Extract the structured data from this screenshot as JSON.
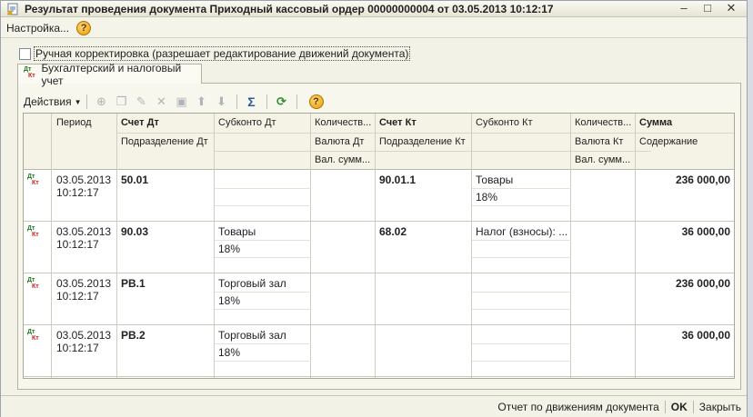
{
  "window": {
    "title": "Результат проведения документа Приходный кассовый ордер 00000000004 от 03.05.2013 10:12:17",
    "buttons": {
      "minimize": "–",
      "maximize": "□",
      "close": "✕"
    }
  },
  "menubar": {
    "settings_label": "Настройка...",
    "help_glyph": "?"
  },
  "manual_correction": {
    "label": "Ручная корректировка (разрешает редактирование движений документа)",
    "checked": false
  },
  "tab": {
    "label": "Бухгалтерский и налоговый учет",
    "icon_dt": "Дт",
    "icon_kt": "Кт"
  },
  "toolbar": {
    "actions_label": "Действия",
    "icons": [
      "add-icon",
      "copy-icon",
      "edit-icon",
      "delete-icon",
      "save-icon",
      "move-up-icon",
      "move-down-icon",
      "sum-icon",
      "refresh-icon",
      "help-icon"
    ]
  },
  "grid": {
    "header": {
      "period": "Период",
      "account_dt": "Счет Дт",
      "subconto_dt": "Субконто Дт",
      "quantity_dt": "Количеств...",
      "account_kt": "Счет Кт",
      "subconto_kt": "Субконто Кт",
      "quantity_kt": "Количеств...",
      "amount": "Сумма",
      "division_dt": "Подразделение Дт",
      "currency_dt": "Валюта Дт",
      "division_kt": "Подразделение Кт",
      "currency_kt": "Валюта Кт",
      "content": "Содержание",
      "currency_amount_dt": "Вал. сумм...",
      "currency_amount_kt": "Вал. сумм..."
    },
    "rows": [
      {
        "date": "03.05.2013",
        "time": "10:12:17",
        "account_dt": "50.01",
        "subconto_dt_1": "",
        "subconto_dt_2": "",
        "account_kt": "90.01.1",
        "subconto_kt_1": "Товары",
        "subconto_kt_2": "18%",
        "amount": "236 000,00"
      },
      {
        "date": "03.05.2013",
        "time": "10:12:17",
        "account_dt": "90.03",
        "subconto_dt_1": "Товары",
        "subconto_dt_2": "18%",
        "account_kt": "68.02",
        "subconto_kt_1": "Налог (взносы): ...",
        "subconto_kt_2": "",
        "amount": "36 000,00"
      },
      {
        "date": "03.05.2013",
        "time": "10:12:17",
        "account_dt": "PB.1",
        "subconto_dt_1": "Торговый зал",
        "subconto_dt_2": "18%",
        "account_kt": "",
        "subconto_kt_1": "",
        "subconto_kt_2": "",
        "amount": "236 000,00"
      },
      {
        "date": "03.05.2013",
        "time": "10:12:17",
        "account_dt": "PB.2",
        "subconto_dt_1": "Торговый зал",
        "subconto_dt_2": "18%",
        "account_kt": "",
        "subconto_kt_1": "",
        "subconto_kt_2": "",
        "amount": "36 000,00"
      }
    ]
  },
  "statusbar": {
    "report_label": "Отчет по движениям документа",
    "ok_label": "OK",
    "close_label": "Закрыть"
  }
}
